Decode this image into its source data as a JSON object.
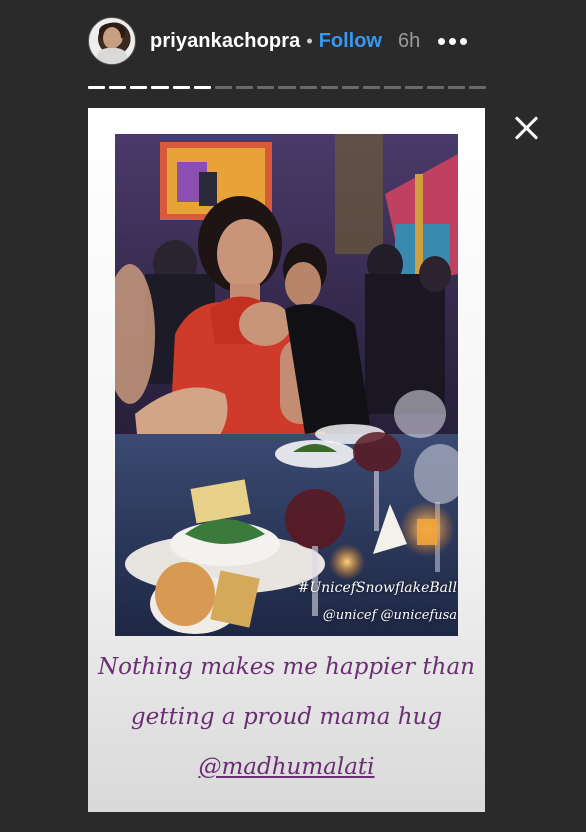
{
  "header": {
    "username": "priyankachopra",
    "separator": "•",
    "follow_label": "Follow",
    "time_ago": "6h"
  },
  "progress": {
    "total_segments": 19,
    "completed_segments": 6
  },
  "story": {
    "hashtag": "#UnicefSnowflakeBall",
    "mentions": "@unicef @unicefusa",
    "caption_line1": "Nothing makes me happier than",
    "caption_line2": "getting a proud mama hug",
    "caption_mention": "@madhumalati"
  },
  "colors": {
    "background": "#2a2a2a",
    "follow": "#3897f0",
    "caption": "#6a2f73"
  },
  "icons": {
    "close": "close-icon",
    "more": "more-options-icon"
  }
}
